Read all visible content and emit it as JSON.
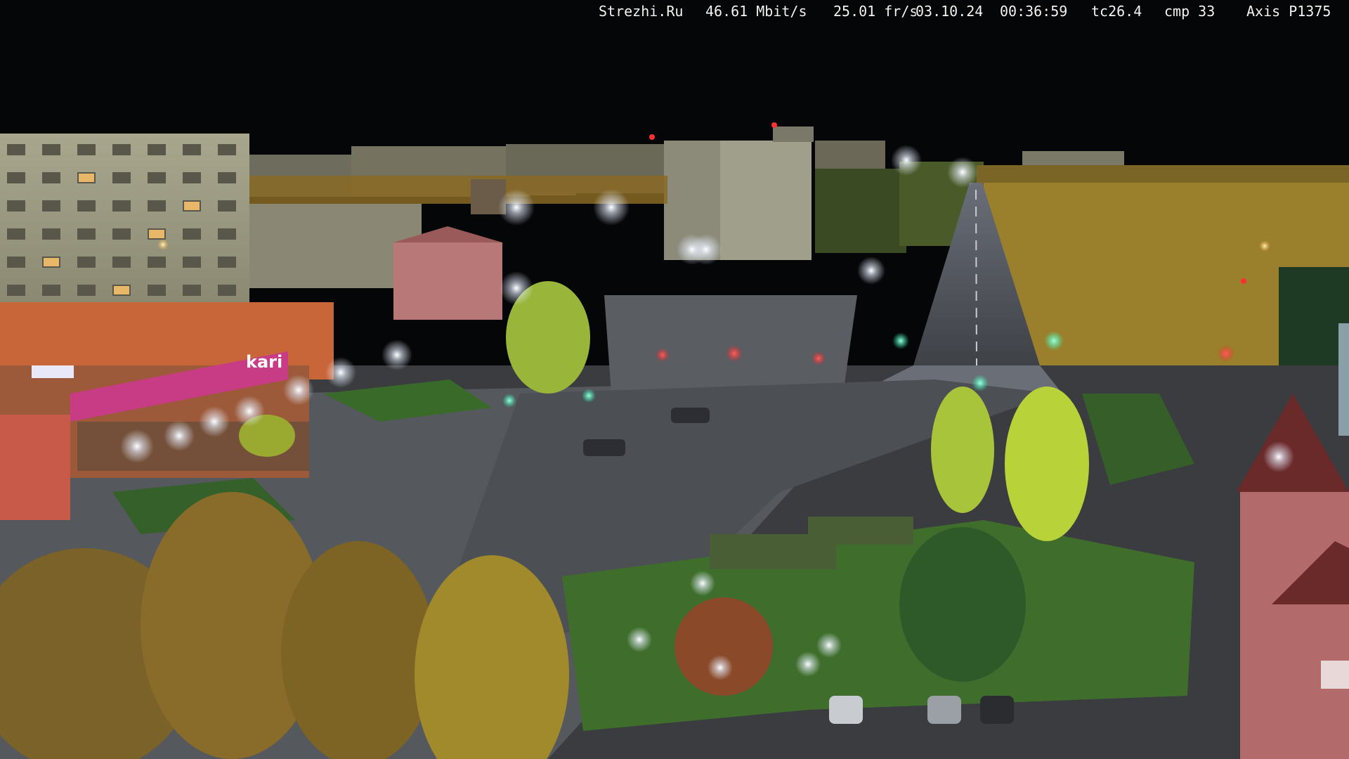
{
  "overlay": {
    "site": "Strezhi.Ru",
    "bitrate": "46.61 Mbit/s",
    "fps": "25.01 fr/s",
    "date": "03.10.24",
    "time": "00:36:59",
    "tc": "tc26.4",
    "cmp": "cmp 33",
    "camera": "Axis P1375"
  },
  "signage": {
    "store_sign": "kari"
  },
  "colors": {
    "night_sky": "#050608",
    "road_asphalt": "#4a4d52",
    "plaza_paving": "#585b5f",
    "grass": "#3f6a2c",
    "autumn_foliage": "#b8902c",
    "lit_foliage": "#b8d23a",
    "store_facade": "#c8663a",
    "store_sign": "#d23c8a",
    "apartment_block": "#9a9a82",
    "streetlight": "#f4f8ff",
    "traffic_red": "#ff2a2a",
    "traffic_green": "#30ffb0"
  }
}
